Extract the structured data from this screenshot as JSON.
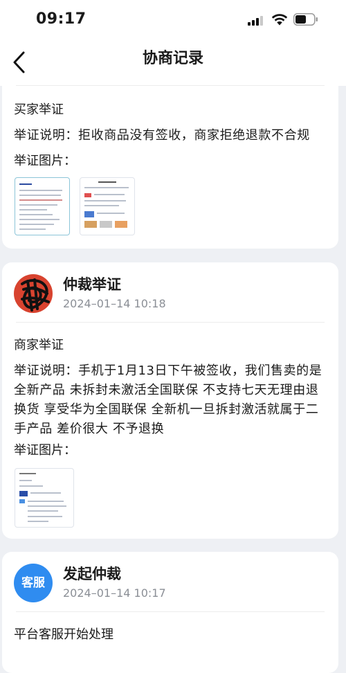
{
  "status_bar": {
    "time": "09:17"
  },
  "nav": {
    "title": "协商记录"
  },
  "buyer_evidence": {
    "party": "买家举证",
    "description": "举证说明：拒收商品没有签收，商家拒绝退款不合规",
    "images_label": "举证图片："
  },
  "arbitration_evidence": {
    "title": "仲裁举证",
    "timestamp": "2024–01–14 10:18",
    "party": "商家举证",
    "description": "举证说明：手机于1月13日下午被签收，我们售卖的是全新产品 未拆封未激活全国联保 不支持七天无理由退换货 享受华为全国联保 全新机一旦拆封激活就属于二手产品 差价很大 不予退换",
    "images_label": "举证图片："
  },
  "start_arbitration": {
    "avatar_text": "客服",
    "title": "发起仲裁",
    "timestamp": "2024–01–14 10:17",
    "message": "平台客服开始处理"
  },
  "colors": {
    "accent_blue": "#2f8cf0",
    "page_bg": "#eef0f4",
    "avatar_red": "#d8432f"
  }
}
